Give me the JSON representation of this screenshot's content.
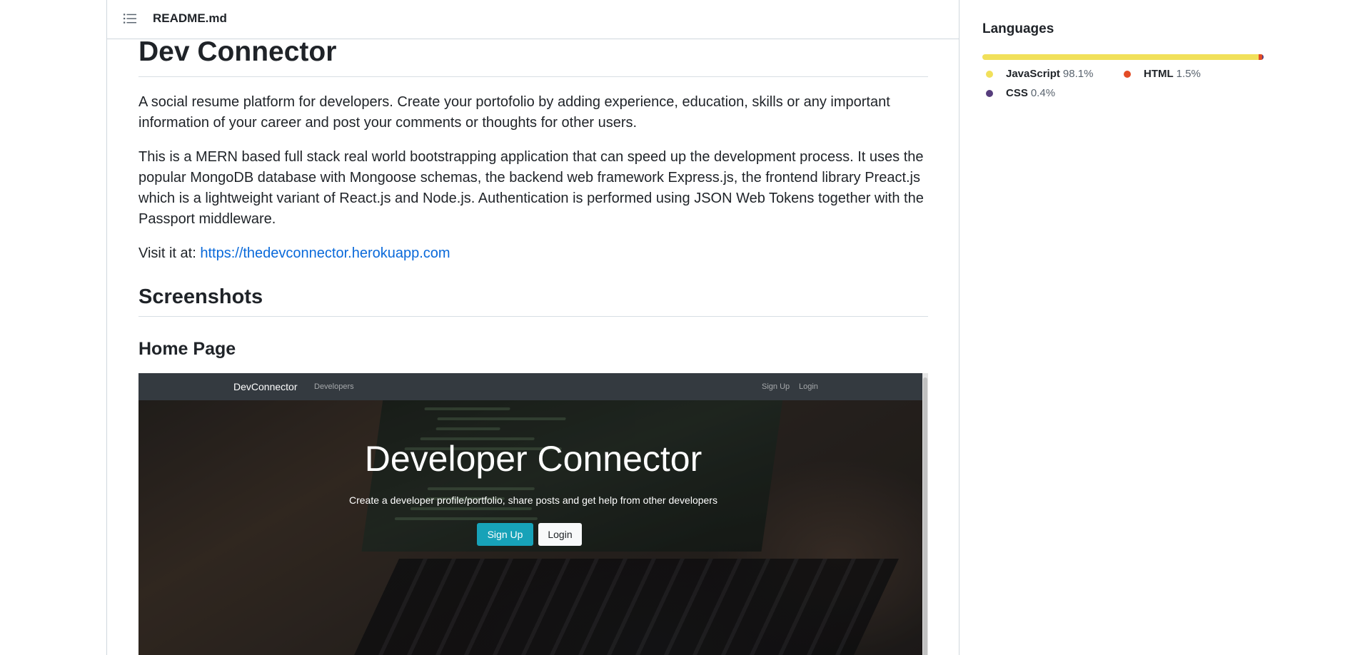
{
  "header": {
    "filename": "README.md",
    "toc_icon": "list-unordered-icon"
  },
  "readme": {
    "title": "Dev Connector",
    "intro": "A social resume platform for developers. Create your portofolio by adding experience, education, skills or any important information of your career and post your comments or thoughts for other users.",
    "description": "This is a MERN based full stack real world bootstrapping application that can speed up the development process. It uses the popular MongoDB database with Mongoose schemas, the backend web framework Express.js, the frontend library Preact.js which is a lightweight variant of React.js and Node.js. Authentication is performed using JSON Web Tokens together with the Passport middleware.",
    "visit_label": "Visit it at:",
    "visit_link": "https://thedevconnector.herokuapp.com",
    "screenshots_heading": "Screenshots",
    "home_page_heading": "Home Page"
  },
  "screenshot": {
    "brand": "DevConnector",
    "nav_developers": "Developers",
    "nav_signup": "Sign Up",
    "nav_login": "Login",
    "hero_title": "Developer Connector",
    "hero_subtitle": "Create a developer profile/portfolio, share posts and get help from other developers",
    "btn_signup": "Sign Up",
    "btn_login": "Login",
    "colors": {
      "navbar": "#343a40",
      "signup_button": "#17a2b8",
      "login_button": "#f8f9fa"
    }
  },
  "languages": {
    "title": "Languages",
    "items": [
      {
        "name": "JavaScript",
        "percent": "98.1%",
        "value": 98.1,
        "color": "#f1e05a"
      },
      {
        "name": "HTML",
        "percent": "1.5%",
        "value": 1.5,
        "color": "#e34c26"
      },
      {
        "name": "CSS",
        "percent": "0.4%",
        "value": 0.4,
        "color": "#563d7c"
      }
    ]
  }
}
